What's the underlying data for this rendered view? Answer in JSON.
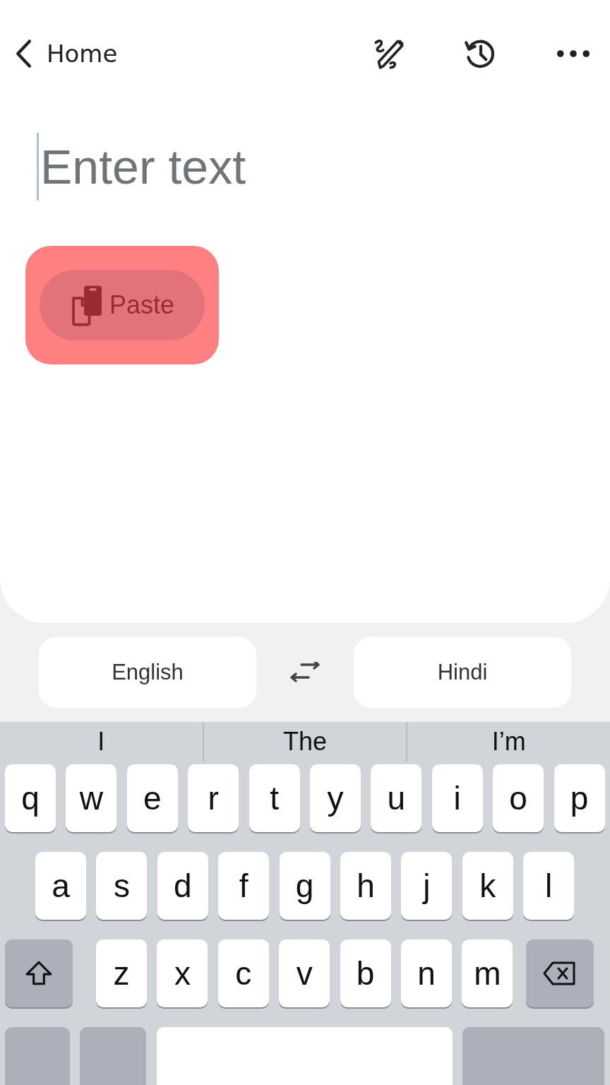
{
  "top_bar": {
    "back_label": "Home"
  },
  "input": {
    "placeholder": "Enter text"
  },
  "paste_button": {
    "label": "Paste",
    "highlighted": true
  },
  "languages": {
    "source": "English",
    "target": "Hindi"
  },
  "suggestions": [
    "I",
    "The",
    "I’m"
  ],
  "keyboard": {
    "rows": [
      [
        "q",
        "w",
        "e",
        "r",
        "t",
        "y",
        "u",
        "i",
        "o",
        "p"
      ],
      [
        "a",
        "s",
        "d",
        "f",
        "g",
        "h",
        "j",
        "k",
        "l"
      ],
      [
        "z",
        "x",
        "c",
        "v",
        "b",
        "n",
        "m"
      ]
    ]
  }
}
